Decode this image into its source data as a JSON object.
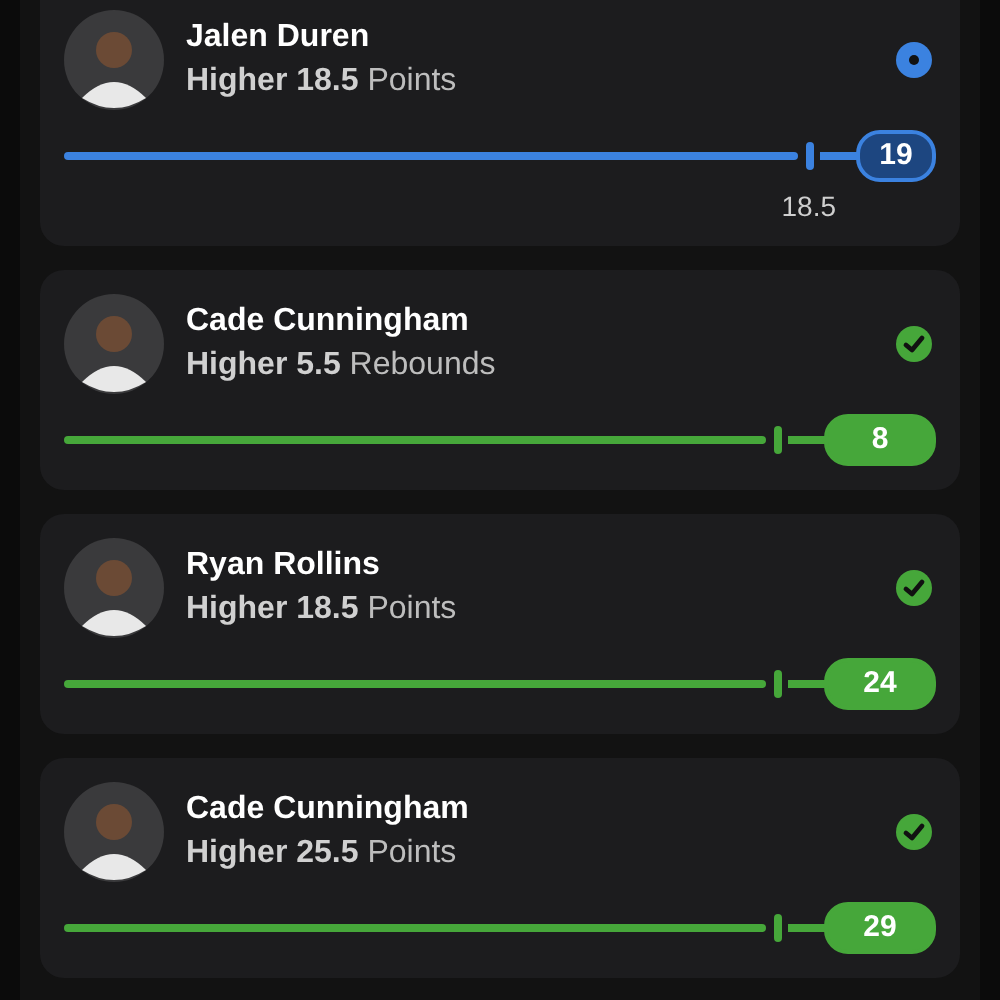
{
  "picks": [
    {
      "player": "Jalen Duren",
      "direction": "Higher",
      "line": "18.5",
      "stat": "Points",
      "kind": "live",
      "result": "19",
      "line_label": "18.5"
    },
    {
      "player": "Cade Cunningham",
      "direction": "Higher",
      "line": "5.5",
      "stat": "Rebounds",
      "kind": "hit",
      "result": "8"
    },
    {
      "player": "Ryan Rollins",
      "direction": "Higher",
      "line": "18.5",
      "stat": "Points",
      "kind": "hit",
      "result": "24"
    },
    {
      "player": "Cade Cunningham",
      "direction": "Higher",
      "line": "25.5",
      "stat": "Points",
      "kind": "hit",
      "result": "29"
    }
  ]
}
